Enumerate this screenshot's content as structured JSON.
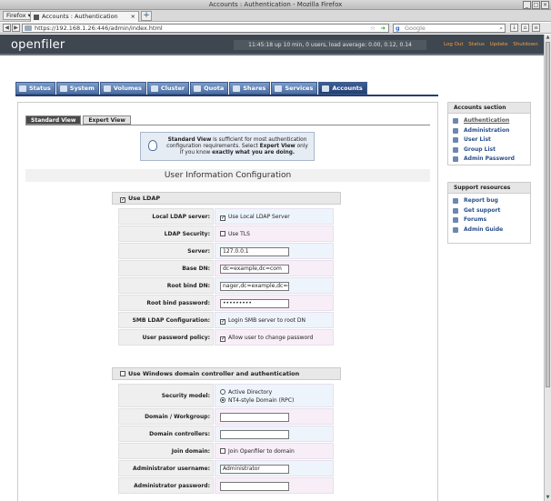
{
  "window": {
    "title": "Accounts : Authentication - Mozilla Firefox"
  },
  "browser": {
    "menu_label": "Firefox",
    "tab_title": "Accounts : Authentication",
    "new_tab": "+",
    "url": "https://192.168.1.26:446/admin/index.html",
    "search_placeholder": "Google"
  },
  "header": {
    "logo": "openfiler",
    "status": "11:45:18 up 10 min, 0 users, load average: 0.00, 0.12, 0.14",
    "links": [
      "Log Out",
      "Status",
      "Update",
      "Shutdown"
    ]
  },
  "main_tabs": [
    "Status",
    "System",
    "Volumes",
    "Cluster",
    "Quota",
    "Shares",
    "Services",
    "Accounts"
  ],
  "sub_tabs": [
    "Standard View",
    "Expert View"
  ],
  "info": {
    "line1_bold": "Standard View",
    "line1_rest": " is sufficient for most authentication configuration requirements. Select ",
    "line1_bold2": "Expert View",
    "line1_end": " only if you know ",
    "line2_bold": "exactly what you are doing."
  },
  "page_title": "User Information Configuration",
  "ldap": {
    "section_label": "Use LDAP",
    "rows": [
      {
        "label": "Local LDAP server:",
        "check": "Use Local LDAP Server",
        "checked": true
      },
      {
        "label": "LDAP Security:",
        "check": "Use TLS",
        "checked": false
      },
      {
        "label": "Server:",
        "input": "127.0.0.1"
      },
      {
        "label": "Base DN:",
        "input": "dc=example,dc=com"
      },
      {
        "label": "Root bind DN:",
        "input": "nager,dc=example,dc=com"
      },
      {
        "label": "Root bind password:",
        "input": "•••••••••"
      },
      {
        "label": "SMB LDAP Configuration:",
        "check": "Login SMB server to root DN",
        "checked": true
      },
      {
        "label": "User password policy:",
        "check": "Allow user to change password",
        "checked": true
      }
    ]
  },
  "windows": {
    "section_label": "Use Windows domain controller and authentication",
    "security_label": "Security model:",
    "radio1": "Active Directory",
    "radio2": "NT4-style Domain (RPC)",
    "rows": [
      {
        "label": "Domain / Workgroup:",
        "input": ""
      },
      {
        "label": "Domain controllers:",
        "input": ""
      },
      {
        "label": "Join domain:",
        "check": "Join Openfiler to domain",
        "checked": false
      },
      {
        "label": "Administrator username:",
        "input": "Administrator"
      },
      {
        "label": "Administrator password:",
        "input": ""
      }
    ]
  },
  "accounts_section": {
    "title": "Accounts section",
    "items": [
      "Authentication",
      "Administration",
      "User List",
      "Group List",
      "Admin Password"
    ]
  },
  "support_section": {
    "title": "Support resources",
    "items": [
      "Report bug",
      "Get support",
      "Forums",
      "Admin Guide"
    ]
  }
}
